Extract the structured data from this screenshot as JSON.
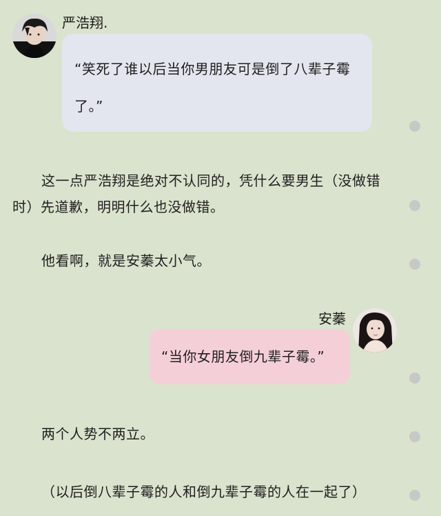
{
  "messages": {
    "left": {
      "sender": "严浩翔.",
      "avatar": "boy-avatar",
      "bubble_line1": "“笑死了谁以后当你男朋友可是倒了八辈子霉",
      "bubble_line2": "了。”"
    },
    "right": {
      "sender": "安蓁",
      "avatar": "girl-avatar",
      "bubble": "“当你女朋友倒九辈子霉。”"
    }
  },
  "paragraphs": {
    "p1_line1": "这一点严浩翔是绝对不认同的，凭什么要男生（没做错",
    "p1_line2": "时）先道歉，明明什么也没做错。",
    "p2": "他看啊，就是安蓁太小气。",
    "p3": "两个人势不两立。",
    "p4": "（以后倒八辈子霉的人和倒九辈子霉的人在一起了）"
  },
  "colors": {
    "background": "#dae3cd",
    "left_bubble": "#e3e6ee",
    "right_bubble": "#f5cfd8",
    "dot": "#c6c9c6"
  }
}
